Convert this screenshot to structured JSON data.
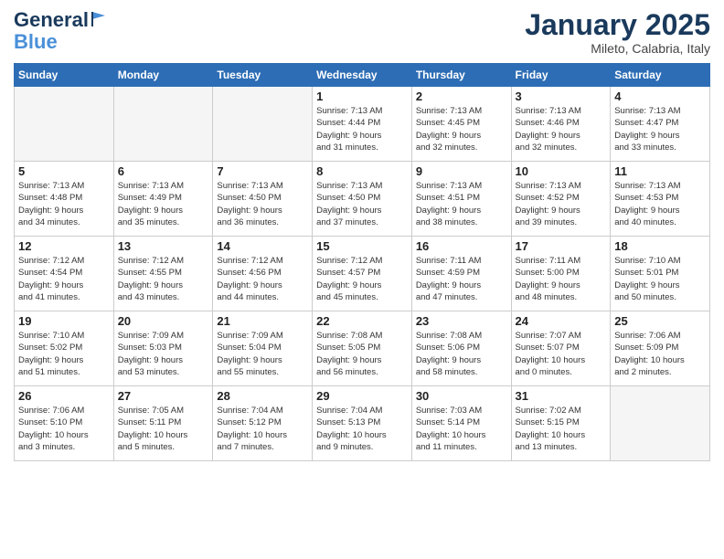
{
  "header": {
    "logo_line1": "General",
    "logo_line2": "Blue",
    "month": "January 2025",
    "location": "Mileto, Calabria, Italy"
  },
  "weekdays": [
    "Sunday",
    "Monday",
    "Tuesday",
    "Wednesday",
    "Thursday",
    "Friday",
    "Saturday"
  ],
  "weeks": [
    [
      {
        "day": "",
        "info": ""
      },
      {
        "day": "",
        "info": ""
      },
      {
        "day": "",
        "info": ""
      },
      {
        "day": "1",
        "info": "Sunrise: 7:13 AM\nSunset: 4:44 PM\nDaylight: 9 hours\nand 31 minutes."
      },
      {
        "day": "2",
        "info": "Sunrise: 7:13 AM\nSunset: 4:45 PM\nDaylight: 9 hours\nand 32 minutes."
      },
      {
        "day": "3",
        "info": "Sunrise: 7:13 AM\nSunset: 4:46 PM\nDaylight: 9 hours\nand 32 minutes."
      },
      {
        "day": "4",
        "info": "Sunrise: 7:13 AM\nSunset: 4:47 PM\nDaylight: 9 hours\nand 33 minutes."
      }
    ],
    [
      {
        "day": "5",
        "info": "Sunrise: 7:13 AM\nSunset: 4:48 PM\nDaylight: 9 hours\nand 34 minutes."
      },
      {
        "day": "6",
        "info": "Sunrise: 7:13 AM\nSunset: 4:49 PM\nDaylight: 9 hours\nand 35 minutes."
      },
      {
        "day": "7",
        "info": "Sunrise: 7:13 AM\nSunset: 4:50 PM\nDaylight: 9 hours\nand 36 minutes."
      },
      {
        "day": "8",
        "info": "Sunrise: 7:13 AM\nSunset: 4:50 PM\nDaylight: 9 hours\nand 37 minutes."
      },
      {
        "day": "9",
        "info": "Sunrise: 7:13 AM\nSunset: 4:51 PM\nDaylight: 9 hours\nand 38 minutes."
      },
      {
        "day": "10",
        "info": "Sunrise: 7:13 AM\nSunset: 4:52 PM\nDaylight: 9 hours\nand 39 minutes."
      },
      {
        "day": "11",
        "info": "Sunrise: 7:13 AM\nSunset: 4:53 PM\nDaylight: 9 hours\nand 40 minutes."
      }
    ],
    [
      {
        "day": "12",
        "info": "Sunrise: 7:12 AM\nSunset: 4:54 PM\nDaylight: 9 hours\nand 41 minutes."
      },
      {
        "day": "13",
        "info": "Sunrise: 7:12 AM\nSunset: 4:55 PM\nDaylight: 9 hours\nand 43 minutes."
      },
      {
        "day": "14",
        "info": "Sunrise: 7:12 AM\nSunset: 4:56 PM\nDaylight: 9 hours\nand 44 minutes."
      },
      {
        "day": "15",
        "info": "Sunrise: 7:12 AM\nSunset: 4:57 PM\nDaylight: 9 hours\nand 45 minutes."
      },
      {
        "day": "16",
        "info": "Sunrise: 7:11 AM\nSunset: 4:59 PM\nDaylight: 9 hours\nand 47 minutes."
      },
      {
        "day": "17",
        "info": "Sunrise: 7:11 AM\nSunset: 5:00 PM\nDaylight: 9 hours\nand 48 minutes."
      },
      {
        "day": "18",
        "info": "Sunrise: 7:10 AM\nSunset: 5:01 PM\nDaylight: 9 hours\nand 50 minutes."
      }
    ],
    [
      {
        "day": "19",
        "info": "Sunrise: 7:10 AM\nSunset: 5:02 PM\nDaylight: 9 hours\nand 51 minutes."
      },
      {
        "day": "20",
        "info": "Sunrise: 7:09 AM\nSunset: 5:03 PM\nDaylight: 9 hours\nand 53 minutes."
      },
      {
        "day": "21",
        "info": "Sunrise: 7:09 AM\nSunset: 5:04 PM\nDaylight: 9 hours\nand 55 minutes."
      },
      {
        "day": "22",
        "info": "Sunrise: 7:08 AM\nSunset: 5:05 PM\nDaylight: 9 hours\nand 56 minutes."
      },
      {
        "day": "23",
        "info": "Sunrise: 7:08 AM\nSunset: 5:06 PM\nDaylight: 9 hours\nand 58 minutes."
      },
      {
        "day": "24",
        "info": "Sunrise: 7:07 AM\nSunset: 5:07 PM\nDaylight: 10 hours\nand 0 minutes."
      },
      {
        "day": "25",
        "info": "Sunrise: 7:06 AM\nSunset: 5:09 PM\nDaylight: 10 hours\nand 2 minutes."
      }
    ],
    [
      {
        "day": "26",
        "info": "Sunrise: 7:06 AM\nSunset: 5:10 PM\nDaylight: 10 hours\nand 3 minutes."
      },
      {
        "day": "27",
        "info": "Sunrise: 7:05 AM\nSunset: 5:11 PM\nDaylight: 10 hours\nand 5 minutes."
      },
      {
        "day": "28",
        "info": "Sunrise: 7:04 AM\nSunset: 5:12 PM\nDaylight: 10 hours\nand 7 minutes."
      },
      {
        "day": "29",
        "info": "Sunrise: 7:04 AM\nSunset: 5:13 PM\nDaylight: 10 hours\nand 9 minutes."
      },
      {
        "day": "30",
        "info": "Sunrise: 7:03 AM\nSunset: 5:14 PM\nDaylight: 10 hours\nand 11 minutes."
      },
      {
        "day": "31",
        "info": "Sunrise: 7:02 AM\nSunset: 5:15 PM\nDaylight: 10 hours\nand 13 minutes."
      },
      {
        "day": "",
        "info": ""
      }
    ]
  ]
}
